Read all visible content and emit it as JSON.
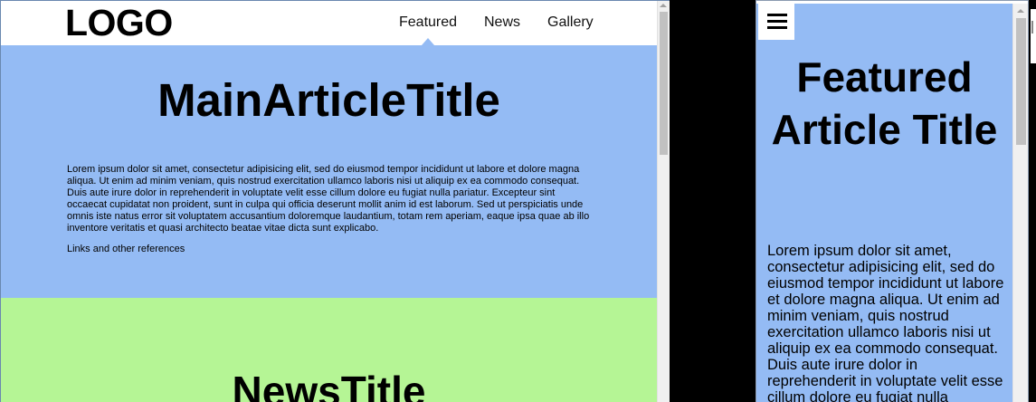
{
  "desktop": {
    "logo": "LOGO",
    "nav": [
      {
        "label": "Featured"
      },
      {
        "label": "News"
      },
      {
        "label": "Gallery"
      }
    ],
    "featured": {
      "title": "MainArticleTitle",
      "body": "Lorem ipsum dolor sit amet, consectetur adipisicing elit, sed do eiusmod tempor incididunt ut labore et dolore magna aliqua. Ut enim ad minim veniam, quis nostrud exercitation ullamco laboris nisi ut aliquip ex ea commodo consequat. Duis aute irure dolor in reprehenderit in voluptate velit esse cillum dolore eu fugiat nulla pariatur. Excepteur sint occaecat cupidatat non proident, sunt in culpa qui officia deserunt mollit anim id est laborum. Sed ut perspiciatis unde omnis iste natus error sit voluptatem accusantium doloremque laudantium, totam rem aperiam, eaque ipsa quae ab illo inventore veritatis et quasi architecto beatae vitae dicta sunt explicabo.",
      "links": "Links and other references"
    },
    "news": {
      "title": "NewsTitle"
    }
  },
  "mobile": {
    "title": "Featured Article Title",
    "body": "Lorem ipsum dolor sit amet, consectetur adipisicing elit, sed do eiusmod tempor incididunt ut labore et dolore magna aliqua. Ut enim ad minim veniam, quis nostrud exercitation ullamco laboris nisi ut aliquip ex ea commodo consequat. Duis aute irure dolor in reprehenderit in voluptate velit esse cillum dolore eu fugiat nulla pariatur."
  },
  "colors": {
    "featured_bg": "#94bbf4",
    "news_bg": "#b5f595",
    "page_bg": "#000000"
  },
  "icons": {
    "menu": "hamburger-menu-icon",
    "scroll_up": "scroll-up-arrow-icon"
  }
}
